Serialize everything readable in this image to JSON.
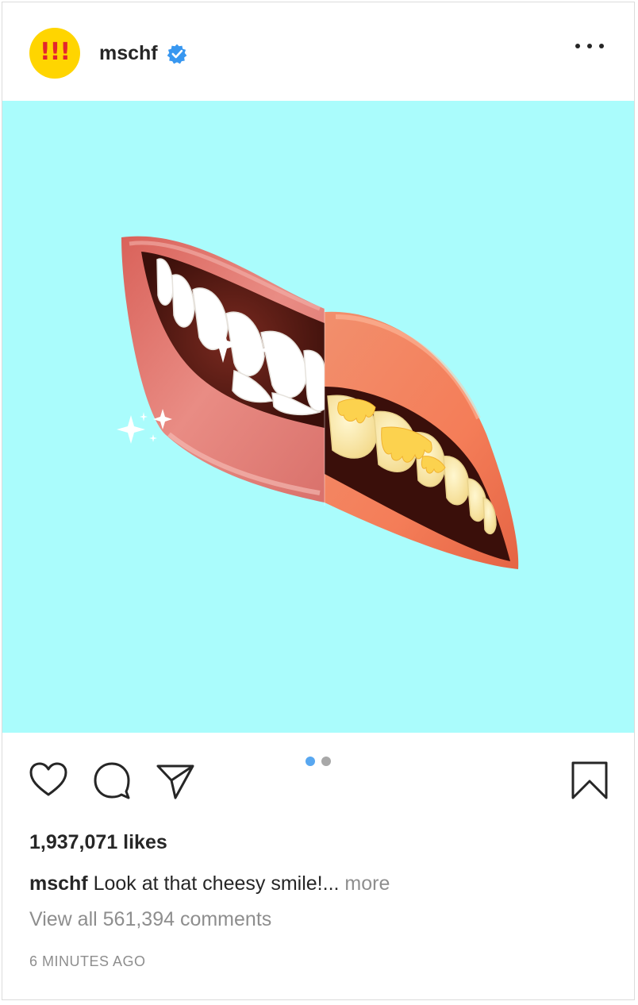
{
  "post": {
    "avatar_text": "!!!",
    "username": "mschf",
    "verified_icon": "verified-badge-icon",
    "more_icon": "more-options-icon",
    "media_background": "#aafcfc",
    "carousel": {
      "total": 2,
      "active": 1
    },
    "likes_text": "1,937,071 likes",
    "caption_user": "mschf",
    "caption_text": " Look at that cheesy smile!...",
    "caption_more": " more",
    "comments_text": "View all 561,394 comments",
    "timestamp": "6 MINUTES AGO"
  },
  "actions": {
    "like_icon": "heart-icon",
    "comment_icon": "comment-icon",
    "share_icon": "share-icon",
    "save_icon": "bookmark-icon"
  },
  "colors": {
    "avatar_bg": "#ffd500",
    "avatar_text": "#e3262d",
    "verified": "#3897f0",
    "active_dot": "#58a7f0",
    "muted": "#8e8e8e"
  }
}
